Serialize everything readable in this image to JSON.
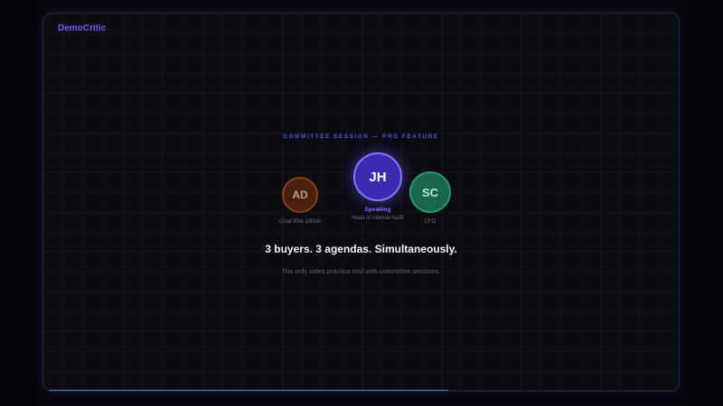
{
  "brand": {
    "name": "DemoCritic"
  },
  "session": {
    "eyebrow": "COMMITTEE SESSION — PRO FEATURE",
    "participants": [
      {
        "initials": "AD",
        "role": "Chief Risk Officer",
        "color": "#a0461e",
        "speaking": false
      },
      {
        "initials": "JH",
        "role": "Head of Internal Audit",
        "color": "#8078ff",
        "speaking": true,
        "status": "Speaking"
      },
      {
        "initials": "SC",
        "role": "CFO",
        "color": "#2b946c",
        "speaking": false
      }
    ],
    "headline": "3 buyers. 3 agendas. Simultaneously.",
    "subtext": "The only sales practice tool with committee sessions."
  },
  "progress": {
    "fraction": 0.64,
    "color": "#7069f0"
  }
}
